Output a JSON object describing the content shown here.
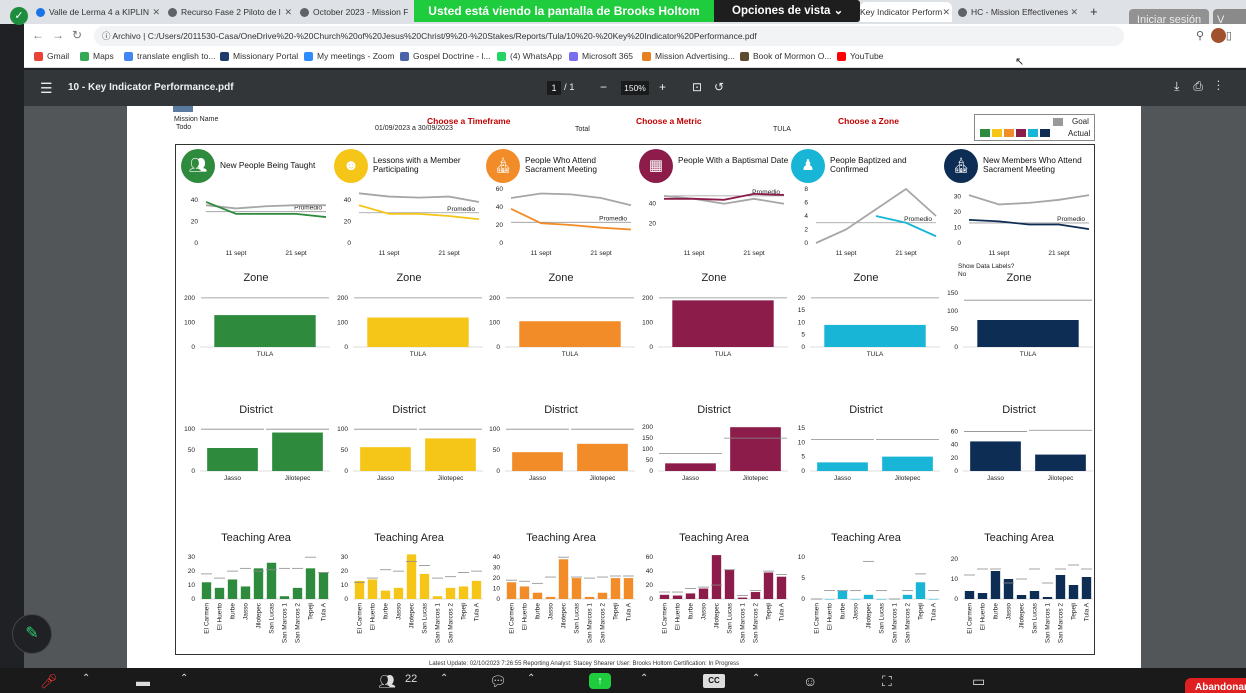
{
  "browser": {
    "tabs": [
      {
        "label": "Valle de Lerma 4 a KIPLIN",
        "color": "#1a73e8"
      },
      {
        "label": "Recurso Fase 2 Piloto de l",
        "color": "#5f6368"
      },
      {
        "label": "October 2023 - Mission F",
        "color": "#5f6368"
      },
      {
        "label": "Key Indicator Perform",
        "color": "#1a73e8"
      },
      {
        "label": "HC - Mission Effectivenes",
        "color": "#5f6368"
      }
    ],
    "new_tab": "+",
    "sign_in": "Iniciar sesión",
    "v_label": "V",
    "url_prefix": "Archivo",
    "url": "C:/Users/2011530-Casa/OneDrive%20-%20Church%20of%20Jesus%20Christ/9%20-%20Stakes/Reports/Tula/10%20-%20Key%20Indicator%20Performance.pdf",
    "bookmarks": [
      {
        "label": "Gmail",
        "color": "#ea4335"
      },
      {
        "label": "Maps",
        "color": "#34a853"
      },
      {
        "label": "translate english to...",
        "color": "#4285f4"
      },
      {
        "label": "Missionary Portal",
        "color": "#1d3b6b"
      },
      {
        "label": "My meetings - Zoom",
        "color": "#2d8cff"
      },
      {
        "label": "Gospel Doctrine - l...",
        "color": "#4b63a8"
      },
      {
        "label": "(4) WhatsApp",
        "color": "#25d366"
      },
      {
        "label": "Microsoft 365",
        "color": "#7a6cf0"
      },
      {
        "label": "Mission Advertising...",
        "color": "#e67e22"
      },
      {
        "label": "Book of Mormon O...",
        "color": "#5d4b2f"
      },
      {
        "label": "YouTube",
        "color": "#ff0000"
      }
    ]
  },
  "share_banner": {
    "text": "Usted está viendo la pantalla de Brooks Holtom",
    "menu": "Opciones de vista"
  },
  "pdf": {
    "title": "10 - Key Indicator Performance.pdf",
    "page": "1",
    "total": "/  1",
    "zoom": "150%"
  },
  "report": {
    "mission_name": "Mission Name",
    "todo": "Todo",
    "date_range": "01/09/2023 a 30/09/2023",
    "total": "Total",
    "tula": "TULA",
    "choose_timeframe": "Choose a Timeframe",
    "choose_metric": "Choose a Metric",
    "choose_zone": "Choose a Zone",
    "legend_goal": "Goal",
    "legend_actual": "Actual",
    "promedio": "Promedio",
    "show_labels": "Show Data Labels?",
    "show_labels_val": "No",
    "zone_title": "Zone",
    "district_title": "District",
    "area_title": "Teaching Area",
    "xdates": [
      "11 sept",
      "21 sept"
    ],
    "footer": "Latest Update: 02/10/2023 7:26:55        Reporting Analyst: Stacey Shearer        User: Brooks Holtom        Certification: In Progress"
  },
  "chart_data": [
    {
      "type": "line",
      "title": "New People Being Taught",
      "color": "#2e8b3e",
      "icon": "people-icon",
      "x": [
        "",
        "11 sept",
        "",
        "21 sept",
        ""
      ],
      "yticks": [
        0,
        20,
        40
      ],
      "ylim": [
        0,
        50
      ],
      "goal": [
        35,
        32,
        34,
        35,
        35
      ],
      "actual": [
        38,
        27,
        27,
        27,
        24
      ],
      "promedio": 29
    },
    {
      "type": "line",
      "title": "Lessons with a Member Participating",
      "color": "#f5c518",
      "icon": "members-icon",
      "x": [
        "",
        "11 sept",
        "",
        "21 sept",
        ""
      ],
      "yticks": [
        0,
        20,
        40
      ],
      "ylim": [
        0,
        50
      ],
      "goal": [
        46,
        43,
        42,
        43,
        38
      ],
      "actual": [
        35,
        27,
        27,
        25,
        22
      ],
      "promedio": 28
    },
    {
      "type": "line",
      "title": "People Who Attend Sacrament Meeting",
      "color": "#f28c28",
      "icon": "chapel-icon",
      "x": [
        "",
        "11 sept",
        "",
        "21 sept",
        ""
      ],
      "yticks": [
        0,
        20,
        40,
        60
      ],
      "ylim": [
        0,
        60
      ],
      "goal": [
        50,
        55,
        54,
        50,
        42
      ],
      "actual": [
        38,
        22,
        20,
        17,
        15
      ],
      "promedio": 23
    },
    {
      "type": "line",
      "title": "People With a Baptismal Date",
      "color": "#8c1c4a",
      "icon": "calendar-icon",
      "x": [
        "",
        "11 sept",
        "",
        "21 sept",
        ""
      ],
      "yticks": [
        20,
        40
      ],
      "ylim": [
        0,
        55
      ],
      "goal": [
        48,
        45,
        40,
        45,
        40
      ],
      "actual": [
        45,
        45,
        44,
        50,
        49
      ],
      "promedio": 48
    },
    {
      "type": "line",
      "title": "People Baptized and Confirmed",
      "color": "#19b5d6",
      "icon": "baptism-icon",
      "x": [
        "",
        "11 sept",
        "",
        "21 sept",
        ""
      ],
      "yticks": [
        0,
        2,
        4,
        6,
        8
      ],
      "ylim": [
        0,
        8
      ],
      "goal": [
        0,
        2,
        5,
        8,
        4
      ],
      "actual": [
        null,
        null,
        4,
        3,
        1
      ],
      "promedio": 3
    },
    {
      "type": "line",
      "title": "New Members Who Attend Sacrament Meeting",
      "color": "#0d2d55",
      "icon": "chapel-icon",
      "x": [
        "",
        "11 sept",
        "",
        "21 sept",
        ""
      ],
      "yticks": [
        0,
        10,
        20,
        30
      ],
      "ylim": [
        0,
        35
      ],
      "goal": [
        31,
        25,
        26,
        28,
        31
      ],
      "actual": [
        15,
        14,
        12,
        12,
        9
      ],
      "promedio": 13
    },
    {
      "type": "bar",
      "section": "Zone",
      "categories": [
        "TULA"
      ],
      "series": [
        {
          "color": "#2e8b3e",
          "values": [
            130
          ]
        }
      ],
      "goal": [
        200
      ],
      "yticks": [
        0,
        100,
        200
      ],
      "ylim": [
        0,
        220
      ]
    },
    {
      "type": "bar",
      "section": "Zone",
      "categories": [
        "TULA"
      ],
      "series": [
        {
          "color": "#f5c518",
          "values": [
            120
          ]
        }
      ],
      "goal": [
        200
      ],
      "yticks": [
        0,
        100,
        200
      ],
      "ylim": [
        0,
        220
      ]
    },
    {
      "type": "bar",
      "section": "Zone",
      "categories": [
        "TULA"
      ],
      "series": [
        {
          "color": "#f28c28",
          "values": [
            105
          ]
        }
      ],
      "goal": [
        200
      ],
      "yticks": [
        0,
        100,
        200
      ],
      "ylim": [
        0,
        220
      ]
    },
    {
      "type": "bar",
      "section": "Zone",
      "categories": [
        "TULA"
      ],
      "series": [
        {
          "color": "#8c1c4a",
          "values": [
            190
          ]
        }
      ],
      "goal": [
        200
      ],
      "yticks": [
        0,
        100,
        200
      ],
      "ylim": [
        0,
        220
      ]
    },
    {
      "type": "bar",
      "section": "Zone",
      "categories": [
        "TULA"
      ],
      "series": [
        {
          "color": "#19b5d6",
          "values": [
            9
          ]
        }
      ],
      "goal": [
        20
      ],
      "yticks": [
        0,
        5,
        10,
        15,
        20
      ],
      "ylim": [
        0,
        22
      ]
    },
    {
      "type": "bar",
      "section": "Zone",
      "categories": [
        "TULA"
      ],
      "series": [
        {
          "color": "#0d2d55",
          "values": [
            75
          ]
        }
      ],
      "goal": [
        130
      ],
      "yticks": [
        0,
        50,
        100,
        150
      ],
      "ylim": [
        0,
        150
      ]
    },
    {
      "type": "bar",
      "section": "District",
      "categories": [
        "Jasso",
        "Jilotepec"
      ],
      "series": [
        {
          "color": "#2e8b3e",
          "values": [
            55,
            92
          ]
        }
      ],
      "goal": [
        100,
        100
      ],
      "yticks": [
        0,
        50,
        100
      ],
      "ylim": [
        0,
        110
      ]
    },
    {
      "type": "bar",
      "section": "District",
      "categories": [
        "Jasso",
        "Jilotepec"
      ],
      "series": [
        {
          "color": "#f5c518",
          "values": [
            57,
            78
          ]
        }
      ],
      "goal": [
        100,
        100
      ],
      "yticks": [
        0,
        50,
        100
      ],
      "ylim": [
        0,
        110
      ]
    },
    {
      "type": "bar",
      "section": "District",
      "categories": [
        "Jasso",
        "Jilotepec"
      ],
      "series": [
        {
          "color": "#f28c28",
          "values": [
            45,
            65
          ]
        }
      ],
      "goal": [
        100,
        100
      ],
      "yticks": [
        0,
        50,
        100
      ],
      "ylim": [
        0,
        110
      ]
    },
    {
      "type": "bar",
      "section": "District",
      "categories": [
        "Jasso",
        "Jilotepec"
      ],
      "series": [
        {
          "color": "#8c1c4a",
          "values": [
            35,
            200
          ]
        }
      ],
      "goal": [
        80,
        150
      ],
      "yticks": [
        0,
        50,
        100,
        150,
        200
      ],
      "ylim": [
        0,
        210
      ]
    },
    {
      "type": "bar",
      "section": "District",
      "categories": [
        "Jasso",
        "Jilotepec"
      ],
      "series": [
        {
          "color": "#19b5d6",
          "values": [
            3,
            5
          ]
        }
      ],
      "goal": [
        11,
        11
      ],
      "yticks": [
        0,
        5,
        10,
        15
      ],
      "ylim": [
        0,
        16
      ]
    },
    {
      "type": "bar",
      "section": "District",
      "categories": [
        "Jasso",
        "Jilotepec"
      ],
      "series": [
        {
          "color": "#0d2d55",
          "values": [
            45,
            25
          ]
        }
      ],
      "goal": [
        60,
        62
      ],
      "yticks": [
        0,
        20,
        40,
        60
      ],
      "ylim": [
        0,
        70
      ]
    },
    {
      "type": "bar",
      "section": "Teaching Area",
      "categories": [
        "El Carmen",
        "El Huerto",
        "Iturbe",
        "Jasso",
        "Jilotepec",
        "San Lucas",
        "San Marcos 1",
        "San Marcos 2",
        "Tepeji",
        "Tula A"
      ],
      "series": [
        {
          "color": "#2e8b3e",
          "values": [
            12,
            8,
            14,
            9,
            22,
            26,
            2,
            8,
            22,
            19
          ]
        }
      ],
      "goal": [
        18,
        15,
        20,
        22,
        20,
        21,
        22,
        22,
        30,
        19
      ],
      "yticks": [
        0,
        10,
        20,
        30
      ],
      "ylim": [
        0,
        33
      ]
    },
    {
      "type": "bar",
      "section": "Teaching Area",
      "categories": [
        "El Carmen",
        "El Huerto",
        "Iturbe",
        "Jasso",
        "Jilotepec",
        "San Lucas",
        "San Marcos 1",
        "San Marcos 2",
        "Tepeji",
        "Tula A"
      ],
      "series": [
        {
          "color": "#f5c518",
          "values": [
            13,
            14,
            6,
            8,
            32,
            18,
            2,
            8,
            9,
            13
          ]
        }
      ],
      "goal": [
        12,
        15,
        21,
        20,
        27,
        24,
        15,
        16,
        19,
        20
      ],
      "yticks": [
        0,
        10,
        20,
        30
      ],
      "ylim": [
        0,
        33
      ]
    },
    {
      "type": "bar",
      "section": "Teaching Area",
      "categories": [
        "El Carmen",
        "El Huerto",
        "Iturbe",
        "Jasso",
        "Jilotepec",
        "San Lucas",
        "San Marcos 1",
        "San Marcos 2",
        "Tepeji",
        "Tula A"
      ],
      "series": [
        {
          "color": "#f28c28",
          "values": [
            16,
            12,
            6,
            2,
            38,
            20,
            2,
            6,
            20,
            20
          ]
        }
      ],
      "goal": [
        18,
        17,
        15,
        21,
        40,
        21,
        20,
        21,
        22,
        22
      ],
      "yticks": [
        0,
        10,
        20,
        30,
        40
      ],
      "ylim": [
        0,
        44
      ]
    },
    {
      "type": "bar",
      "section": "Teaching Area",
      "categories": [
        "El Carmen",
        "El Huerto",
        "Iturbe",
        "Jasso",
        "Jilotepec",
        "San Lucas",
        "San Marcos 1",
        "San Marcos 2",
        "Tepeji",
        "Tula A"
      ],
      "series": [
        {
          "color": "#8c1c4a",
          "values": [
            6,
            5,
            8,
            15,
            63,
            42,
            2,
            10,
            38,
            32
          ]
        }
      ],
      "goal": [
        10,
        10,
        15,
        17,
        20,
        42,
        5,
        12,
        40,
        35
      ],
      "yticks": [
        0,
        20,
        40,
        60
      ],
      "ylim": [
        0,
        66
      ]
    },
    {
      "type": "bar",
      "section": "Teaching Area",
      "categories": [
        "El Carmen",
        "El Huerto",
        "Iturbe",
        "Jasso",
        "Jilotepec",
        "San Lucas",
        "San Marcos 1",
        "San Marcos 2",
        "Tepeji",
        "Tula A"
      ],
      "series": [
        {
          "color": "#19b5d6",
          "values": [
            0,
            0,
            2,
            0,
            1,
            0,
            0,
            1,
            4,
            0
          ]
        }
      ],
      "goal": [
        0,
        2,
        2,
        2,
        9,
        2,
        0,
        2,
        6,
        2
      ],
      "yticks": [
        0,
        5,
        10
      ],
      "ylim": [
        0,
        11
      ]
    },
    {
      "type": "bar",
      "section": "Teaching Area",
      "categories": [
        "El Carmen",
        "El Huerto",
        "Iturbe",
        "Jasso",
        "Jilotepec",
        "San Lucas",
        "San Marcos 1",
        "San Marcos 2",
        "Tepeji",
        "Tula A"
      ],
      "series": [
        {
          "color": "#0d2d55",
          "values": [
            4,
            3,
            14,
            10,
            2,
            4,
            1,
            12,
            7,
            11
          ]
        }
      ],
      "goal": [
        12,
        15,
        15,
        8,
        10,
        15,
        8,
        15,
        17,
        15
      ],
      "yticks": [
        0,
        10,
        20
      ],
      "ylim": [
        0,
        23
      ]
    }
  ],
  "zoom_controls": {
    "participants_count": "22",
    "leave": "Abandonar"
  }
}
